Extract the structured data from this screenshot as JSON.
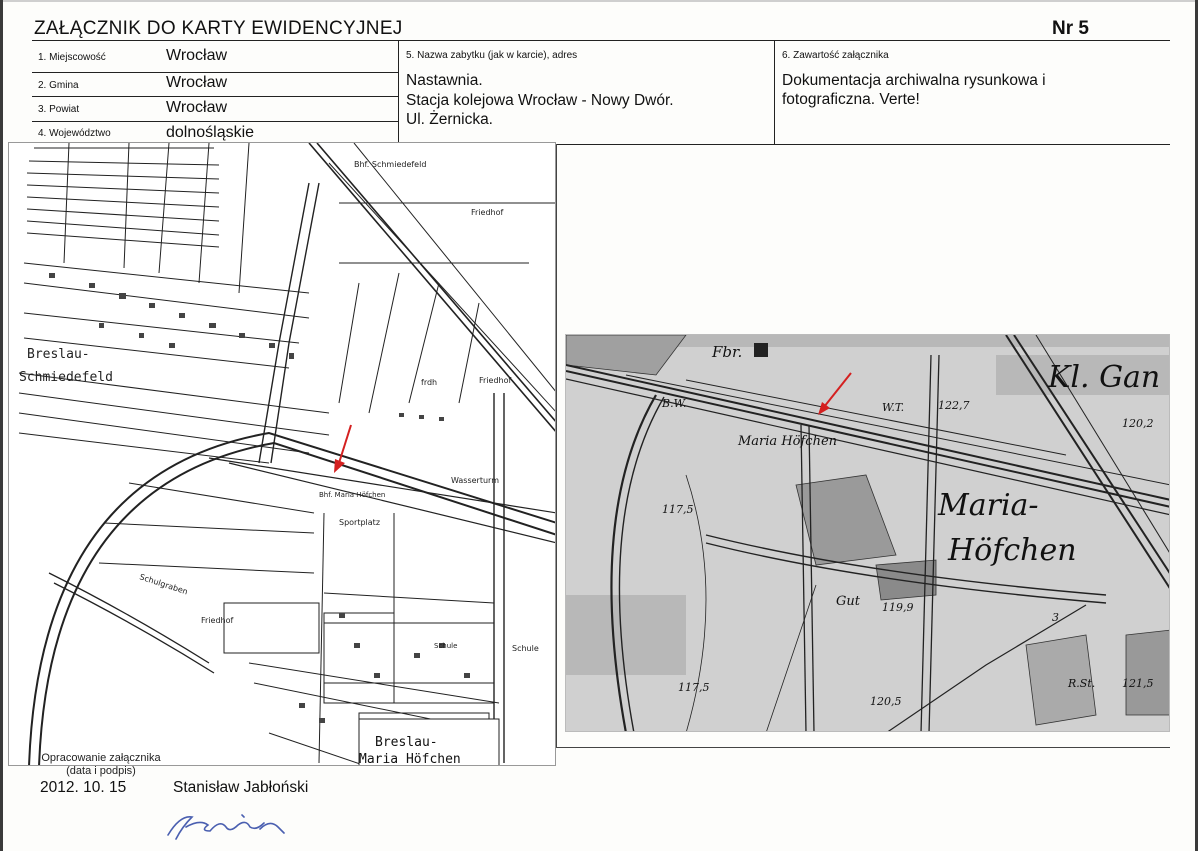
{
  "header": {
    "title": "ZAŁĄCZNIK DO KARTY EWIDENCYJNEJ",
    "number": "Nr 5"
  },
  "fields": {
    "miejscowosc": {
      "label": "1. Miejscowość",
      "value": "Wrocław"
    },
    "gmina": {
      "label": "2. Gmina",
      "value": "Wrocław"
    },
    "powiat": {
      "label": "3. Powiat",
      "value": "Wrocław"
    },
    "wojewodztwo": {
      "label": "4. Województwo",
      "value": "dolnośląskie"
    },
    "nazwa": {
      "label": "5. Nazwa zabytku (jak w karcie), adres",
      "line1": "Nastawnia.",
      "line2": "Stacja kolejowa Wrocław - Nowy Dwór.",
      "line3": "Ul. Żernicka."
    },
    "zawartosc": {
      "label": "6. Zawartość załącznika",
      "line1": "Dokumentacja archiwalna rysunkowa i",
      "line2": "fotograficzna. Verte!"
    }
  },
  "map_left": {
    "labels": {
      "station_top": "Bhf. Schmiedefeld",
      "friedhof_top": "Friedhof",
      "breslau": "Breslau-",
      "schmiedefeld": "Schmiedefeld",
      "frdh": "frdh",
      "friedhof_mid": "Friedhof",
      "wasserturm": "Wasserturm",
      "station_mid": "Bhf. Maria Höfchen",
      "sportplatz": "Sportplatz",
      "schule_small": "Schule",
      "schule": "Schule",
      "friedhof_low": "Friedhof",
      "schulgraben": "Schulgraben",
      "breslau_bottom": "Breslau-",
      "maria_hofchen": "Maria Höfchen"
    }
  },
  "map_right": {
    "labels": {
      "fbr": "Fbr.",
      "kl_gan": "Kl. Gan",
      "bw": "B.W.",
      "wt": "W.T.",
      "h122": "122,7",
      "h120": "120,2",
      "maria_hofchen_small": "Maria Höfchen",
      "maria": "Maria-",
      "hofchen": "Höfchen",
      "h117a": "117,5",
      "gut": "Gut",
      "h119": "119,9",
      "three": "3",
      "h117b": "117,5",
      "h120b": "120,5",
      "rst": "R.St.",
      "h121": "121,5"
    }
  },
  "footer": {
    "label_line1": "Opracowanie załącznika",
    "label_line2": "(data i podpis)",
    "date": "2012. 10. 15",
    "author": "Stanisław Jabłoński"
  },
  "colors": {
    "ink": "#111111",
    "map_gray": "#c8c8c8",
    "arrow_red": "#d42020",
    "signature_blue": "#4a5fb0"
  }
}
